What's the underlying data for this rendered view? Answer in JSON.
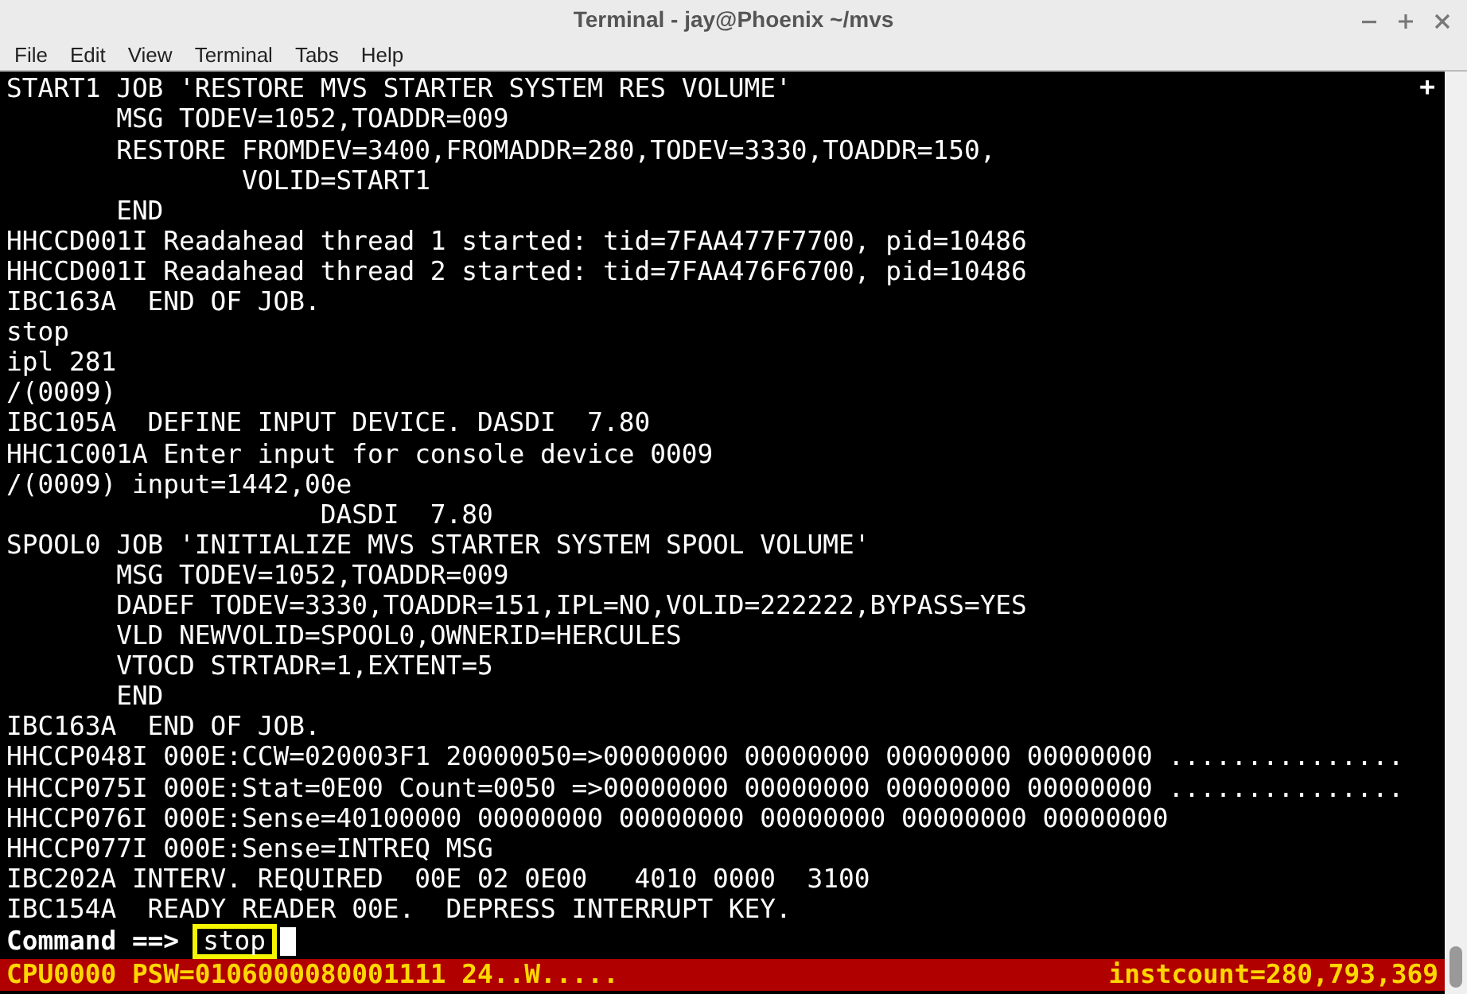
{
  "window": {
    "title": "Terminal - jay@Phoenix ~/mvs"
  },
  "menu": [
    "File",
    "Edit",
    "View",
    "Terminal",
    "Tabs",
    "Help"
  ],
  "terminal": {
    "new_tab_symbol": "+",
    "lines": [
      "START1 JOB 'RESTORE MVS STARTER SYSTEM RES VOLUME'",
      "       MSG TODEV=1052,TOADDR=009",
      "       RESTORE FROMDEV=3400,FROMADDR=280,TODEV=3330,TOADDR=150,",
      "               VOLID=START1",
      "       END",
      "HHCCD001I Readahead thread 1 started: tid=7FAA477F7700, pid=10486",
      "HHCCD001I Readahead thread 2 started: tid=7FAA476F6700, pid=10486",
      "IBC163A  END OF JOB.",
      "stop",
      "ipl 281",
      "/(0009)",
      "IBC105A  DEFINE INPUT DEVICE. DASDI  7.80",
      "HHC1C001A Enter input for console device 0009",
      "/(0009) input=1442,00e",
      "                    DASDI  7.80",
      "SPOOL0 JOB 'INITIALIZE MVS STARTER SYSTEM SPOOL VOLUME'",
      "       MSG TODEV=1052,TOADDR=009",
      "       DADEF TODEV=3330,TOADDR=151,IPL=NO,VOLID=222222,BYPASS=YES",
      "       VLD NEWVOLID=SPOOL0,OWNERID=HERCULES",
      "       VTOCD STRTADR=1,EXTENT=5",
      "       END",
      "IBC163A  END OF JOB.",
      "HHCCP048I 000E:CCW=020003F1 20000050=>00000000 00000000 00000000 00000000 ...............",
      "HHCCP075I 000E:Stat=0E00 Count=0050 =>00000000 00000000 00000000 00000000 ...............",
      "HHCCP076I 000E:Sense=40100000 00000000 00000000 00000000 00000000 00000000",
      "HHCCP077I 000E:Sense=INTREQ MSG",
      "IBC202A INTERV. REQUIRED  00E 02 0E00   4010 0000  3100",
      "IBC154A  READY READER 00E.  DEPRESS INTERRUPT KEY."
    ],
    "prompt": "Command ==>",
    "command": "stop"
  },
  "status_bar": {
    "left": "CPU0000 PSW=0106000080001111 24..W.....",
    "right": "instcount=280,793,369"
  }
}
